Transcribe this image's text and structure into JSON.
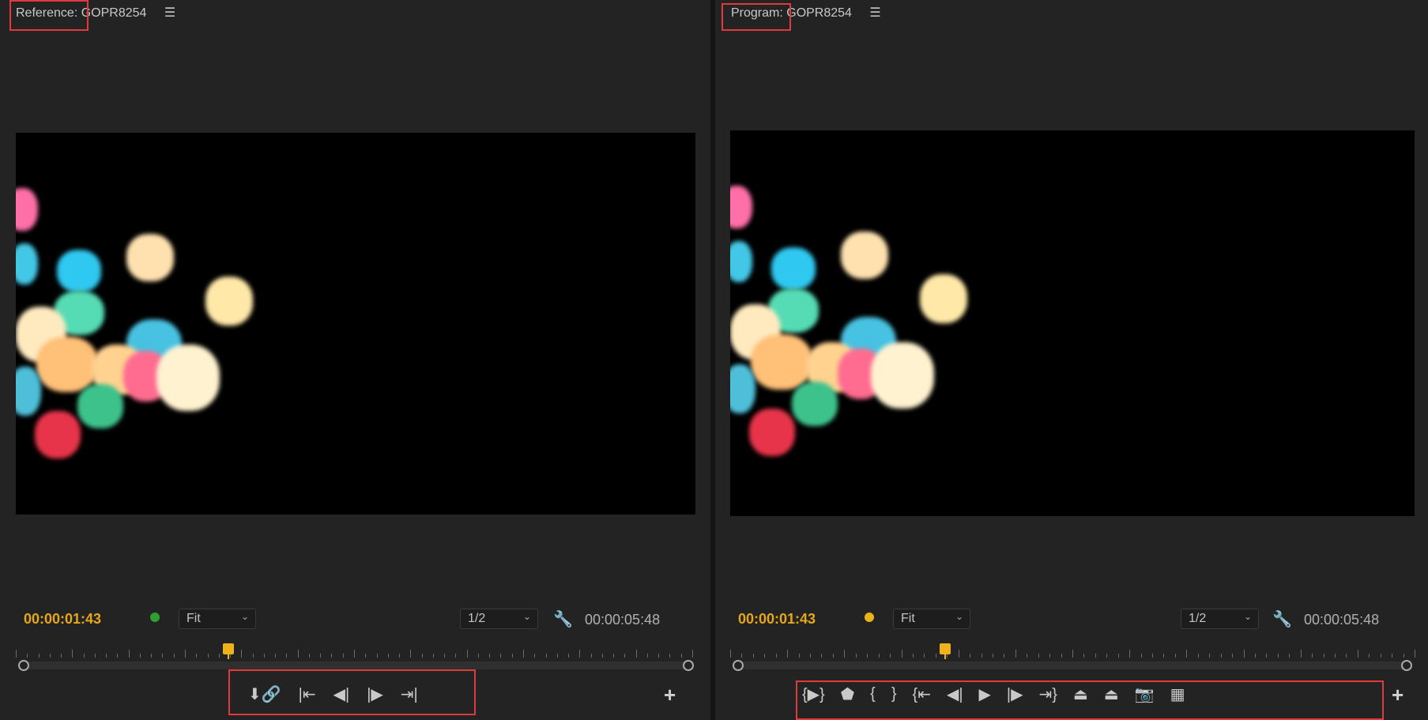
{
  "reference": {
    "title": "Reference: GOPR8254",
    "menu_icon": "☰",
    "timecode": "00:00:01:43",
    "duration": "00:00:05:48",
    "status_color": "#2ea02e",
    "zoom": "Fit",
    "resolution": "1/2",
    "playhead_fraction": 0.31,
    "buttons": [
      {
        "name": "add-marker-link-button",
        "glyph": "⬇🔗"
      },
      {
        "name": "go-to-in-button",
        "glyph": "|⇤"
      },
      {
        "name": "step-back-button",
        "glyph": "◀|"
      },
      {
        "name": "step-forward-button",
        "glyph": "|▶"
      },
      {
        "name": "go-to-out-button",
        "glyph": "⇥|"
      }
    ],
    "add_button": "+"
  },
  "program": {
    "title": "Program: GOPR8254",
    "menu_icon": "☰",
    "timecode": "00:00:01:43",
    "duration": "00:00:05:48",
    "status_color": "#e8b41a",
    "zoom": "Fit",
    "resolution": "1/2",
    "playhead_fraction": 0.31,
    "buttons": [
      {
        "name": "play-in-to-out-button",
        "glyph": "{▶}"
      },
      {
        "name": "add-marker-button",
        "glyph": "⬟"
      },
      {
        "name": "mark-in-button",
        "glyph": "{"
      },
      {
        "name": "mark-out-button",
        "glyph": "}"
      },
      {
        "name": "go-to-in-button",
        "glyph": "{⇤"
      },
      {
        "name": "step-back-button",
        "glyph": "◀|"
      },
      {
        "name": "play-button",
        "glyph": "▶"
      },
      {
        "name": "step-forward-button",
        "glyph": "|▶"
      },
      {
        "name": "go-to-out-button",
        "glyph": "⇥}"
      },
      {
        "name": "lift-button",
        "glyph": "⏏"
      },
      {
        "name": "extract-button",
        "glyph": "⏏"
      },
      {
        "name": "export-frame-button",
        "glyph": "📷"
      },
      {
        "name": "comparison-view-button",
        "glyph": "▦"
      }
    ],
    "add_button": "+"
  }
}
